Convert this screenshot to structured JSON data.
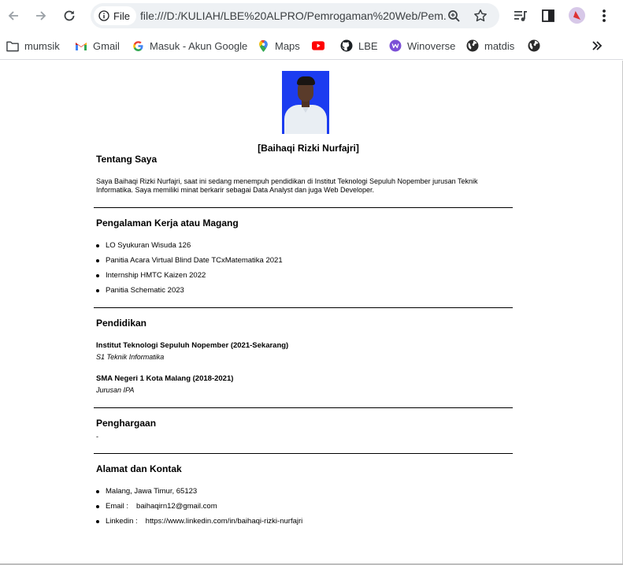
{
  "browser": {
    "back_icon": "arrow-left-icon",
    "forward_icon": "arrow-right-icon",
    "reload_icon": "reload-icon",
    "file_chip_label": "File",
    "url": "file:///D:/KULIAH/LBE%20ALPRO/Pemrogaman%20Web/Pem...",
    "zoom_icon": "zoom-icon",
    "bookmark_star_icon": "star-icon",
    "media_icon": "media-controls-icon",
    "sidepanel_icon": "side-panel-icon",
    "profile_icon": "profile-avatar",
    "menu_icon": "kebab-menu-icon"
  },
  "bookmarks": [
    {
      "label": "mumsik",
      "icon": "folder-icon"
    },
    {
      "label": "Gmail",
      "icon": "gmail-icon"
    },
    {
      "label": "Masuk - Akun Google",
      "icon": "google-icon"
    },
    {
      "label": "Maps",
      "icon": "maps-icon"
    },
    {
      "label": "",
      "icon": "youtube-icon"
    },
    {
      "label": "LBE",
      "icon": "github-icon"
    },
    {
      "label": "Winoverse",
      "icon": "winoverse-icon"
    },
    {
      "label": "matdis",
      "icon": "globe-icon"
    },
    {
      "label": "",
      "icon": "globe-icon"
    }
  ],
  "bookmarks_overflow_icon": "double-chevron-right-icon",
  "profile": {
    "name": "[Baihaqi Rizki Nurfajri]"
  },
  "about": {
    "heading": "Tentang Saya",
    "text": "Saya Baihaqi Rizki Nurfajri, saat ini sedang menempuh pendidikan di Institut Teknologi Sepuluh Nopember jurusan Teknik Informatika. Saya memiliki minat berkarir sebagai Data Analyst dan juga Web Developer."
  },
  "experience": {
    "heading": "Pengalaman Kerja atau Magang",
    "items": [
      "LO Syukuran Wisuda 126",
      "Panitia Acara Virtual Blind Date TCxMatematika 2021",
      "Internship HMTC Kaizen 2022",
      "Panitia Schematic 2023"
    ]
  },
  "education": {
    "heading": "Pendidikan",
    "entries": [
      {
        "school": "Institut Teknologi Sepuluh Nopember (2021-Sekarang)",
        "degree": "S1 Teknik Informatika"
      },
      {
        "school": "SMA Negeri 1 Kota Malang (2018-2021)",
        "degree": "Jurusan IPA"
      }
    ]
  },
  "awards": {
    "heading": "Penghargaan",
    "text": "-"
  },
  "contact": {
    "heading": "Alamat dan Kontak",
    "address": "Malang, Jawa Timur, 65123",
    "email_label": "Email :",
    "email_value": "baihaqirn12@gmail.com",
    "linkedin_label": "Linkedin :",
    "linkedin_value": "https://www.linkedin.com/in/baihaqi-rizki-nurfajri"
  }
}
